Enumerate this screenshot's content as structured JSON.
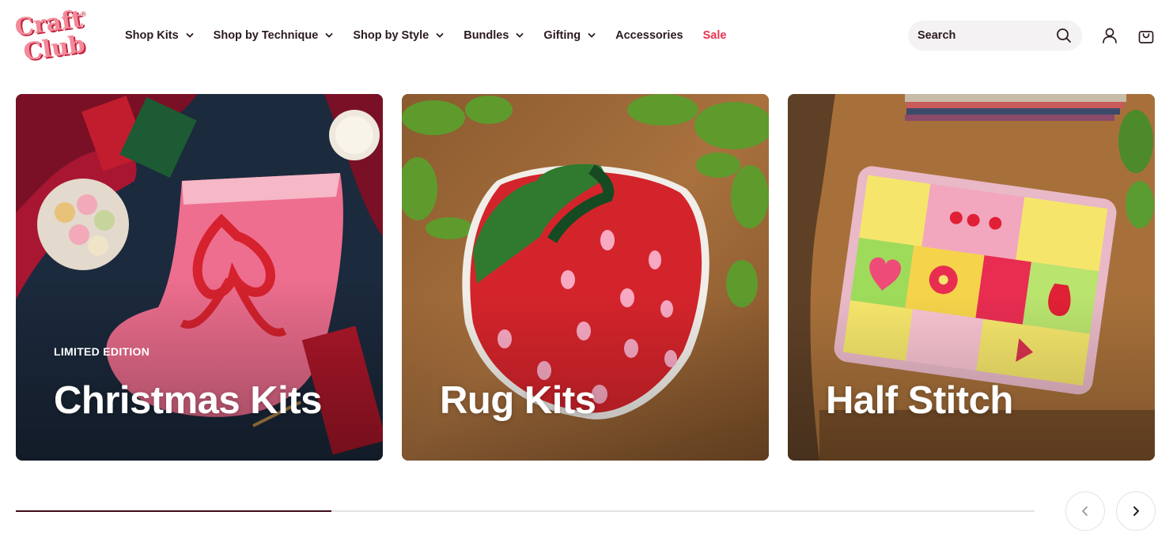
{
  "brand": {
    "logo_line1": "Craft",
    "logo_line2": "Club",
    "registered_mark": "®",
    "logo_color": "#e8314f"
  },
  "nav": {
    "items": [
      {
        "label": "Shop Kits",
        "has_dropdown": true
      },
      {
        "label": "Shop by Technique",
        "has_dropdown": true
      },
      {
        "label": "Shop by Style",
        "has_dropdown": true
      },
      {
        "label": "Bundles",
        "has_dropdown": true
      },
      {
        "label": "Gifting",
        "has_dropdown": true
      },
      {
        "label": "Accessories",
        "has_dropdown": false
      },
      {
        "label": "Sale",
        "has_dropdown": false,
        "color": "#e8314f"
      }
    ]
  },
  "search": {
    "label": "Search",
    "icon": "search-icon"
  },
  "header_icons": [
    "account-icon",
    "cart-icon"
  ],
  "collections": [
    {
      "tag": "LIMITED EDITION",
      "title": "Christmas Kits",
      "image": "pink latch-hook christmas stocking with red bow"
    },
    {
      "tag": "",
      "title": "Rug Kits",
      "image": "strawberry latch-hook rug on wooden table"
    },
    {
      "tag": "",
      "title": "Half Stitch",
      "image": "needlepoint patchwork pouch on wooden desk"
    }
  ],
  "carousel": {
    "progress": 0.31,
    "prev_icon": "chevron-left-icon",
    "next_icon": "chevron-right-icon"
  }
}
